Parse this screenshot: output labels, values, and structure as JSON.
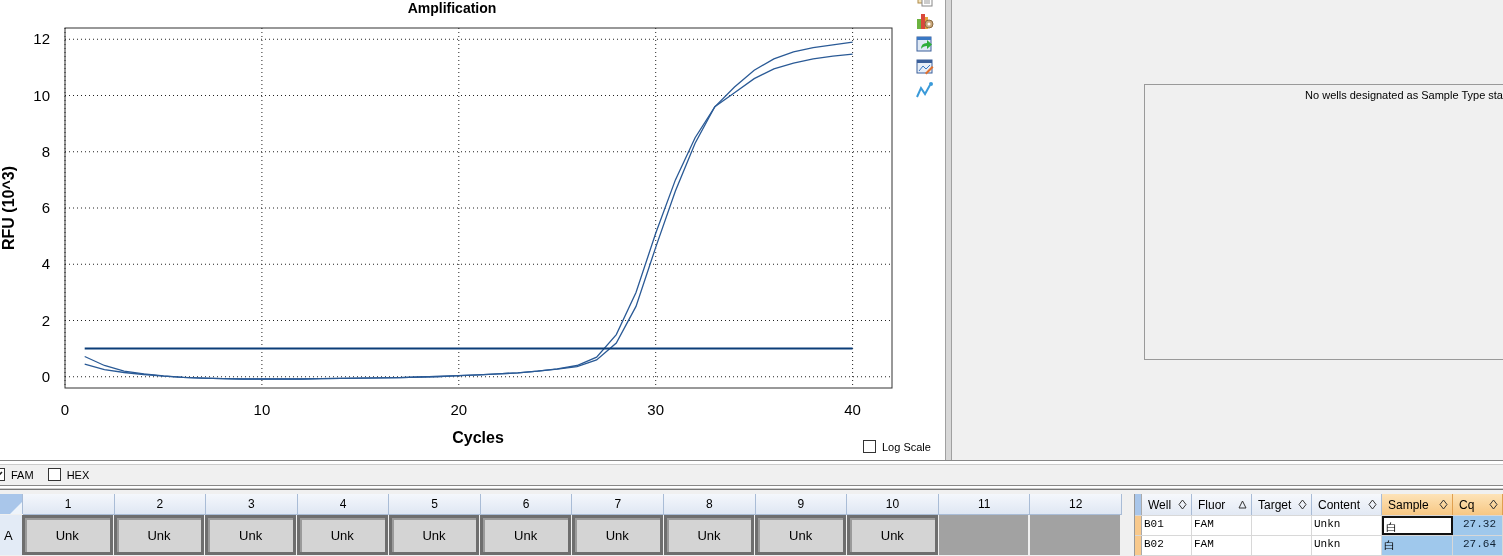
{
  "chart": {
    "chart_data": {
      "type": "line",
      "title": "Amplification",
      "xlabel": "Cycles",
      "ylabel": "RFU (10^3)",
      "x": [
        1,
        2,
        3,
        4,
        5,
        6,
        7,
        8,
        9,
        10,
        11,
        12,
        13,
        14,
        15,
        16,
        17,
        18,
        19,
        20,
        21,
        22,
        23,
        24,
        25,
        26,
        27,
        28,
        29,
        30,
        31,
        32,
        33,
        34,
        35,
        36,
        37,
        38,
        39,
        40
      ],
      "xlim": [
        0,
        42
      ],
      "ylim": [
        -0.4,
        12.4
      ],
      "grid": true,
      "xticks": [
        0,
        10,
        20,
        30,
        40
      ],
      "yticks": [
        0,
        2,
        4,
        6,
        8,
        10,
        12
      ],
      "series": [
        {
          "color": "#2a5a96",
          "values": [
            0.72,
            0.4,
            0.2,
            0.1,
            0.03,
            -0.02,
            -0.05,
            -0.07,
            -0.08,
            -0.08,
            -0.08,
            -0.08,
            -0.07,
            -0.06,
            -0.05,
            -0.04,
            -0.03,
            -0.01,
            0.01,
            0.04,
            0.07,
            0.1,
            0.14,
            0.2,
            0.28,
            0.4,
            0.7,
            1.5,
            3.0,
            5.1,
            7.0,
            8.5,
            9.6,
            10.3,
            10.9,
            11.3,
            11.55,
            11.7,
            11.8,
            11.9
          ]
        },
        {
          "color": "#2a5a96",
          "values": [
            0.45,
            0.25,
            0.15,
            0.08,
            0.02,
            -0.02,
            -0.05,
            -0.07,
            -0.08,
            -0.08,
            -0.08,
            -0.08,
            -0.07,
            -0.06,
            -0.05,
            -0.04,
            -0.03,
            -0.01,
            0.01,
            0.04,
            0.07,
            0.1,
            0.14,
            0.2,
            0.27,
            0.36,
            0.6,
            1.2,
            2.5,
            4.6,
            6.6,
            8.3,
            9.6,
            10.1,
            10.6,
            10.95,
            11.15,
            11.3,
            11.4,
            11.47
          ]
        },
        {
          "color": "#0b3d78",
          "values": [
            1,
            1,
            1,
            1,
            1,
            1,
            1,
            1,
            1,
            1,
            1,
            1,
            1,
            1,
            1,
            1,
            1,
            1,
            1,
            1,
            1,
            1,
            1,
            1,
            1,
            1,
            1,
            1,
            1,
            1,
            1,
            1,
            1,
            1,
            1,
            1,
            1,
            1,
            1,
            1
          ]
        }
      ]
    },
    "log_scale": {
      "label": "Log Scale",
      "checked": false
    }
  },
  "standards_panel": {
    "message": "No wells designated as Sample Type sta"
  },
  "fluor_filters": [
    {
      "label": "FAM",
      "checked": true
    },
    {
      "label": "HEX",
      "checked": false
    }
  ],
  "plate": {
    "columns": [
      "1",
      "2",
      "3",
      "4",
      "5",
      "6",
      "7",
      "8",
      "9",
      "10",
      "11",
      "12"
    ],
    "rows": [
      {
        "label": "A",
        "wells": [
          {
            "kind": "sample",
            "label": "Unk"
          },
          {
            "kind": "sample",
            "label": "Unk"
          },
          {
            "kind": "sample",
            "label": "Unk"
          },
          {
            "kind": "sample",
            "label": "Unk"
          },
          {
            "kind": "sample",
            "label": "Unk"
          },
          {
            "kind": "sample",
            "label": "Unk"
          },
          {
            "kind": "sample",
            "label": "Unk"
          },
          {
            "kind": "sample",
            "label": "Unk"
          },
          {
            "kind": "sample",
            "label": "Unk"
          },
          {
            "kind": "sample",
            "label": "Unk"
          },
          {
            "kind": "empty"
          },
          {
            "kind": "empty"
          }
        ]
      }
    ]
  },
  "results_table": {
    "columns": [
      {
        "label": "Well",
        "sorted": false,
        "selected": false
      },
      {
        "label": "Fluor",
        "sorted": true,
        "selected": false
      },
      {
        "label": "Target",
        "sorted": false,
        "selected": false
      },
      {
        "label": "Content",
        "sorted": false,
        "selected": false
      },
      {
        "label": "Sample",
        "sorted": false,
        "selected": true
      },
      {
        "label": "Cq",
        "sorted": false,
        "selected": true
      }
    ],
    "rows": [
      {
        "focused": true,
        "cells": [
          "B01",
          "FAM",
          null,
          "Unkn",
          "白",
          "27.32"
        ]
      },
      {
        "focused": false,
        "cells": [
          "B02",
          "FAM",
          null,
          "Unkn",
          "白",
          "27.64"
        ]
      }
    ]
  }
}
